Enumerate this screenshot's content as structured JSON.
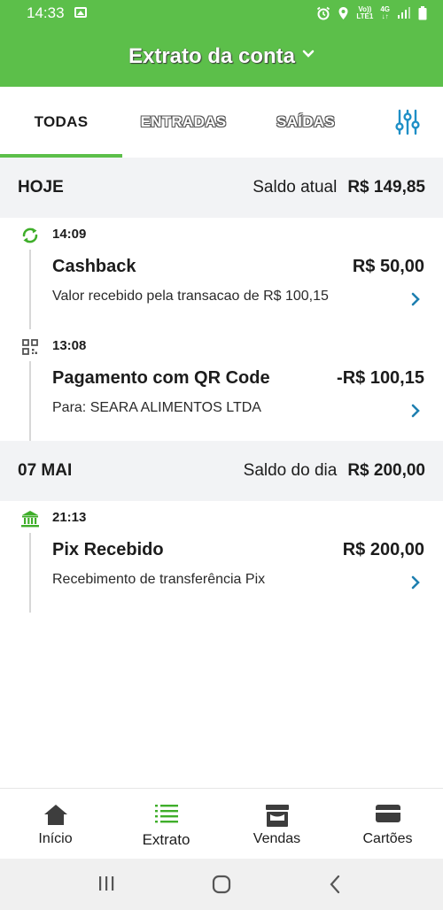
{
  "status_bar": {
    "time": "14:33",
    "icons": [
      "gallery-icon",
      "alarm-icon",
      "location-icon",
      "volte-icon",
      "4g-icon",
      "signal-icon",
      "battery-icon"
    ],
    "volte_label": "Vo))",
    "lte_label": "LTE1",
    "net_label": "4G"
  },
  "header": {
    "title": "Extrato da conta",
    "chevron_icon": "chevron-down-icon",
    "background_color": "#5cbf4a"
  },
  "tabs": {
    "items": [
      {
        "label": "TODAS",
        "active": true
      },
      {
        "label": "ENTRADAS",
        "active": false
      },
      {
        "label": "SAÍDAS",
        "active": false
      }
    ],
    "filter_icon": "filter-sliders-icon",
    "accent_color": "#5cbf4a",
    "filter_color": "#1e8fc6"
  },
  "sections": [
    {
      "date": "HOJE",
      "saldo_label": "Saldo atual",
      "saldo_value": "R$ 149,85",
      "transactions": [
        {
          "icon": "cashback-refresh-icon",
          "time": "14:09",
          "title": "Cashback",
          "amount": "R$ 50,00",
          "description": "Valor recebido pela transacao de R$ 100,15"
        },
        {
          "icon": "qr-code-icon",
          "time": "13:08",
          "title": "Pagamento com QR Code",
          "amount": "-R$ 100,15",
          "description": "Para: SEARA ALIMENTOS LTDA"
        }
      ]
    },
    {
      "date": "07 MAI",
      "saldo_label": "Saldo do dia",
      "saldo_value": "R$ 200,00",
      "transactions": [
        {
          "icon": "bank-icon",
          "time": "21:13",
          "title": "Pix Recebido",
          "amount": "R$ 200,00",
          "description": "Recebimento de transferência Pix"
        }
      ]
    }
  ],
  "bottom_nav": {
    "items": [
      {
        "label": "Início",
        "icon": "home-icon",
        "active": false
      },
      {
        "label": "Extrato",
        "icon": "list-icon",
        "active": true
      },
      {
        "label": "Vendas",
        "icon": "store-icon",
        "active": false
      },
      {
        "label": "Cartões",
        "icon": "card-icon",
        "active": false
      }
    ]
  },
  "system_nav": {
    "icons": [
      "recent-apps-icon",
      "home-circle-icon",
      "back-icon"
    ]
  }
}
